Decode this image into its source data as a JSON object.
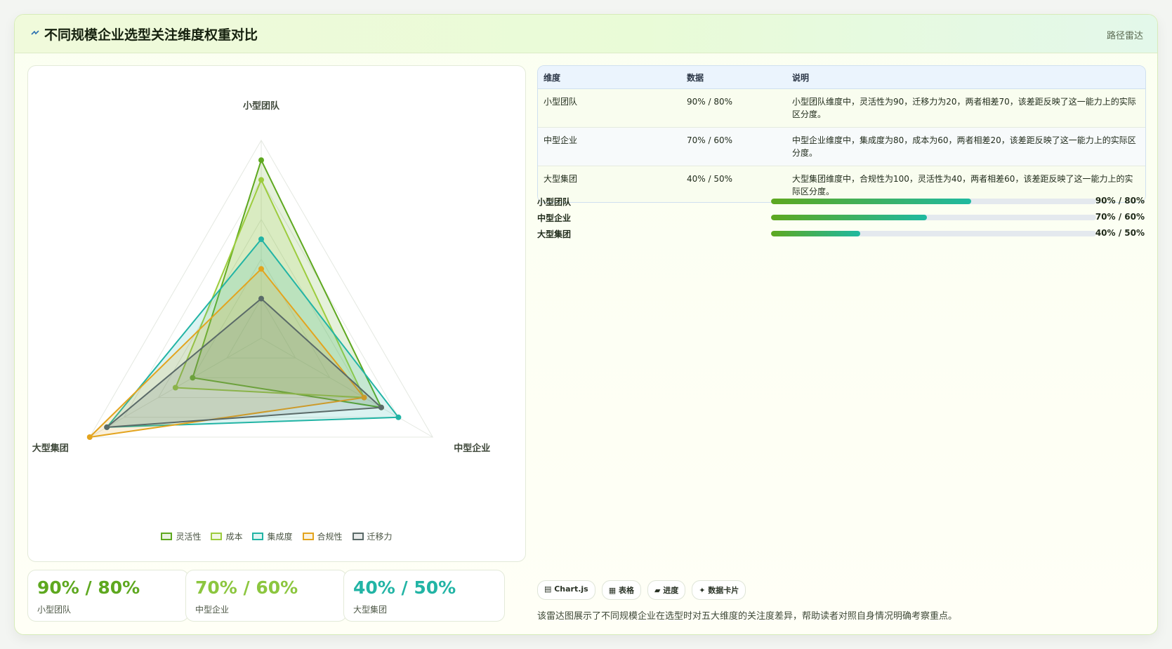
{
  "header": {
    "title": "不同规模企业选型关注维度权重对比",
    "tag": "路径雷达"
  },
  "colors": {
    "灵活性": "#5ea81f",
    "成本": "#9ccc3d",
    "集成度": "#22b4a5",
    "合规性": "#e3a41e",
    "迁移力": "#5a6a68"
  },
  "chart_data": {
    "type": "radar",
    "axes": [
      "小型团队",
      "中型企业",
      "大型集团"
    ],
    "range": [
      0,
      100
    ],
    "series": [
      {
        "name": "灵活性",
        "values": [
          90,
          70,
          40
        ]
      },
      {
        "name": "成本",
        "values": [
          80,
          60,
          50
        ]
      },
      {
        "name": "集成度",
        "values": [
          50,
          80,
          90
        ]
      },
      {
        "name": "合规性",
        "values": [
          35,
          60,
          100
        ]
      },
      {
        "name": "迁移力",
        "values": [
          20,
          70,
          90
        ]
      }
    ],
    "legend_position": "bottom"
  },
  "stats": [
    {
      "value": "90% / 80%",
      "label": "小型团队",
      "color": "#5ea81f"
    },
    {
      "value": "70% / 60%",
      "label": "中型企业",
      "color": "#8cc63f"
    },
    {
      "value": "40% / 50%",
      "label": "大型集团",
      "color": "#22b4a5"
    }
  ],
  "table": {
    "headers": [
      "维度",
      "数据",
      "说明"
    ],
    "rows": [
      {
        "dim": "小型团队",
        "data": "90% / 80%",
        "desc": "小型团队维度中，灵活性为90，迁移力为20，两者相差70，该差距反映了这一能力上的实际区分度。"
      },
      {
        "dim": "中型企业",
        "data": "70% / 60%",
        "desc": "中型企业维度中，集成度为80，成本为60，两者相差20，该差距反映了这一能力上的实际区分度。"
      },
      {
        "dim": "大型集团",
        "data": "40% / 50%",
        "desc": "大型集团维度中，合规性为100，灵活性为40，两者相差60，该差距反映了这一能力上的实际区分度。"
      }
    ]
  },
  "progress": [
    {
      "label": "小型团队",
      "value": "90% / 80%",
      "fraction": 0.615
    },
    {
      "label": "中型企业",
      "value": "70% / 60%",
      "fraction": 0.48
    },
    {
      "label": "大型集团",
      "value": "40% / 50%",
      "fraction": 0.275
    }
  ],
  "badges": [
    "▤ Chart.js",
    "▦ 表格",
    "▰ 进度",
    "✦ 数据卡片"
  ],
  "caption": "该雷达图展示了不同规模企业在选型时对五大维度的关注度差异，帮助读者对照自身情况明确考察重点。"
}
